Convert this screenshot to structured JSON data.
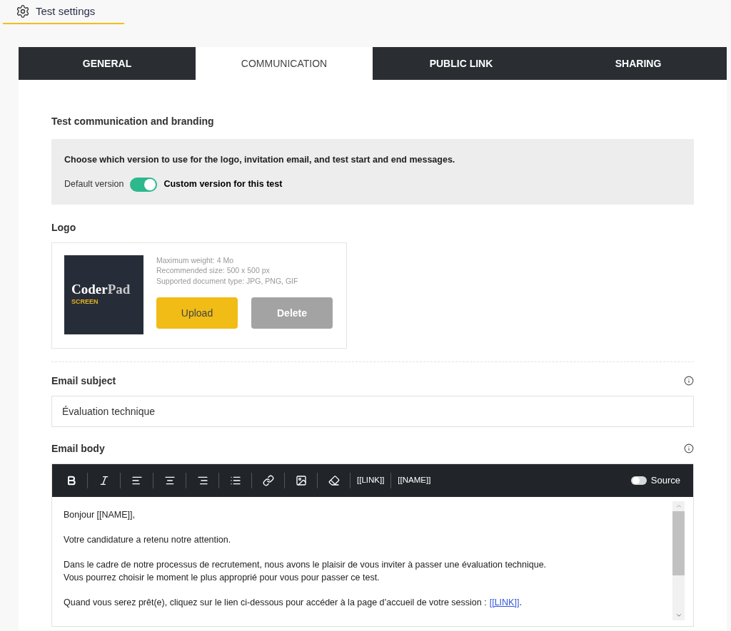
{
  "header": {
    "title": "Test settings"
  },
  "tabs": [
    {
      "label": "GENERAL",
      "selected": false
    },
    {
      "label": "COMMUNICATION",
      "selected": true
    },
    {
      "label": "PUBLIC LINK",
      "selected": false
    },
    {
      "label": "SHARING",
      "selected": false
    }
  ],
  "branding": {
    "heading": "Test communication and branding",
    "description": "Choose which version to use for the logo, invitation email, and test start and end messages.",
    "off_label": "Default version",
    "on_label": "Custom version for this test",
    "on": true
  },
  "logo": {
    "heading": "Logo",
    "brand_name_a": "Coder",
    "brand_name_b": "Pad",
    "brand_sub": "SCREEN",
    "specs": [
      {
        "label": "Maximum weight:",
        "value": "4 Mo"
      },
      {
        "label": "Recommended size:",
        "value": "500 x 500 px"
      },
      {
        "label": "Supported document type:",
        "value": "JPG, PNG, GIF"
      }
    ],
    "buttons": [
      {
        "label": "Upload",
        "disabled": false
      },
      {
        "label": "Delete",
        "disabled": true
      }
    ]
  },
  "email_subject": {
    "label": "Email subject",
    "value": "Évaluation technique"
  },
  "email_body": {
    "label": "Email body",
    "toolbar": [
      {
        "kind": "bold"
      },
      {
        "kind": "italic"
      },
      {
        "kind": "align-left"
      },
      {
        "kind": "align-center"
      },
      {
        "kind": "align-right"
      },
      {
        "kind": "list"
      },
      {
        "kind": "link"
      },
      {
        "kind": "image"
      },
      {
        "kind": "eraser"
      },
      {
        "kind": "text",
        "label": "[[LINK]]"
      },
      {
        "kind": "text",
        "label": "[[NAME]]"
      }
    ],
    "source": {
      "label": "Source",
      "on": false
    },
    "paragraphs": [
      {
        "lines": [
          "Bonjour [[NAME]],"
        ]
      },
      {
        "lines": [
          "Votre candidature a retenu notre attention."
        ]
      },
      {
        "lines": [
          "Dans le cadre de notre processus de recrutement, nous avons le plaisir de vous inviter à passer une évaluation technique.",
          "Vous pourrez choisir le moment le plus approprié pour vous pour passer ce test."
        ]
      },
      {
        "lines": [
          "Quand vous serez prêt(e), cliquez sur le lien ci-dessous pour accéder à la page d’accueil de votre session :"
        ],
        "link": "[[LINK]]",
        "after": "."
      }
    ]
  }
}
